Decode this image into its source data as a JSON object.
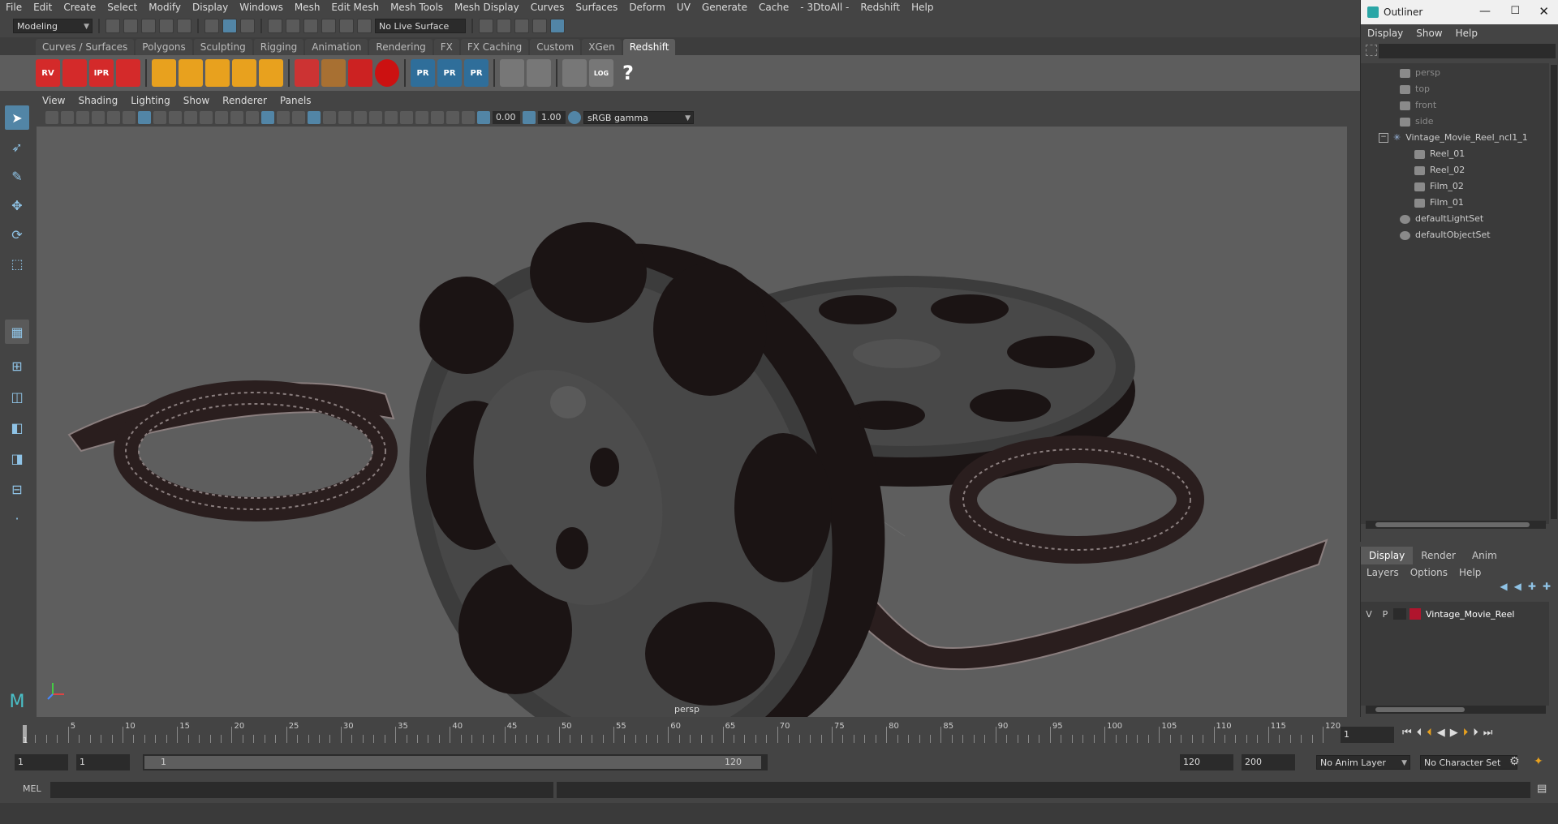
{
  "menubar": [
    "File",
    "Edit",
    "Create",
    "Select",
    "Modify",
    "Display",
    "Windows",
    "Mesh",
    "Edit Mesh",
    "Mesh Tools",
    "Mesh Display",
    "Curves",
    "Surfaces",
    "Deform",
    "UV",
    "Generate",
    "Cache",
    "- 3DtoAll -",
    "Redshift",
    "Help"
  ],
  "status": {
    "workspace": "Modeling",
    "live_surface": "No Live Surface"
  },
  "shelf_tabs": [
    "Curves / Surfaces",
    "Polygons",
    "Sculpting",
    "Rigging",
    "Animation",
    "Rendering",
    "FX",
    "FX Caching",
    "Custom",
    "XGen",
    "Redshift"
  ],
  "shelf_active": "Redshift",
  "shelf_icons": {
    "rv": "RV",
    "ipr": "IPR",
    "pr": "PR",
    "log": "LOG",
    "help": "?"
  },
  "panel_menu": [
    "View",
    "Shading",
    "Lighting",
    "Show",
    "Renderer",
    "Panels"
  ],
  "panel_toolbar": {
    "exposure": "0.00",
    "gamma": "1.00",
    "colorspace": "sRGB gamma"
  },
  "viewport": {
    "camera_label": "persp"
  },
  "outliner": {
    "title": "Outliner",
    "menu": [
      "Display",
      "Show",
      "Help"
    ],
    "cameras": [
      "persp",
      "top",
      "front",
      "side"
    ],
    "group": "Vintage_Movie_Reel_ncl1_1",
    "children": [
      "Reel_01",
      "Reel_02",
      "Film_02",
      "Film_01"
    ],
    "sets": [
      "defaultLightSet",
      "defaultObjectSet"
    ]
  },
  "layers": {
    "tabs": [
      "Display",
      "Render",
      "Anim"
    ],
    "active_tab": "Display",
    "menu": [
      "Layers",
      "Options",
      "Help"
    ],
    "row": {
      "v": "V",
      "p": "P",
      "name": "Vintage_Movie_Reel",
      "color": "#b0152d"
    }
  },
  "timeline": {
    "ticks": [
      "5",
      "10",
      "15",
      "20",
      "25",
      "30",
      "35",
      "40",
      "45",
      "50",
      "55",
      "60",
      "65",
      "70",
      "75",
      "80",
      "85",
      "90",
      "95",
      "100",
      "105",
      "110",
      "115",
      "120"
    ],
    "start_marker": "1",
    "current_frame": "1"
  },
  "range": {
    "start": "1",
    "playback_start": "1",
    "slider_start": "1",
    "slider_end": "120",
    "playback_end": "120",
    "end": "200",
    "anim_layer": "No Anim Layer",
    "char_set": "No Character Set"
  },
  "cmd": {
    "label": "MEL"
  },
  "colors": {
    "accent": "#5285a6",
    "redshift_red": "#d42a2a",
    "reel_dark": "#1b1414",
    "reel_rim": "#3c3c3c",
    "viewport_bg": "#5e5e5e"
  }
}
